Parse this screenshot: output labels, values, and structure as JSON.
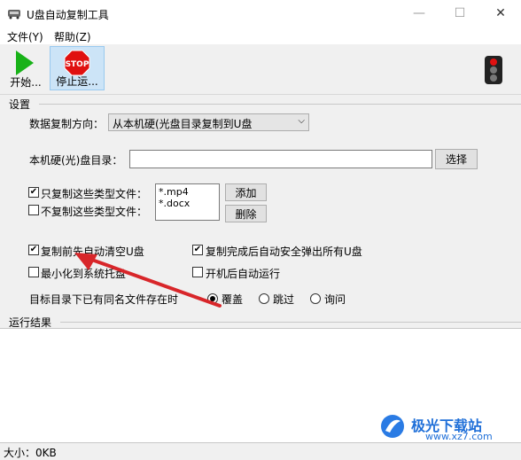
{
  "window": {
    "title": "U盘自动复制工具",
    "min_icon": "minimize-icon",
    "max_icon": "maximize-icon",
    "close_icon": "close-icon"
  },
  "menu": [
    {
      "label": "文件(Y)"
    },
    {
      "label": "帮助(Z)"
    }
  ],
  "toolbar": {
    "start_label": "开始...",
    "stop_label": "停止运...",
    "stop_sign_text": "STOP"
  },
  "settings": {
    "group_label": "设置",
    "direction_label": "数据复制方向：",
    "direction_value": "从本机硬(光盘目录复制到U盘",
    "dir_label": "本机硬(光)盘目录：",
    "dir_value": "",
    "browse_label": "选择",
    "only_types_label": "只复制这些类型文件：",
    "only_types_checked": true,
    "exclude_types_label": "不复制这些类型文件：",
    "exclude_types_checked": false,
    "types_list": [
      "*.mp4",
      "*.docx"
    ],
    "add_label": "添加",
    "delete_label": "删除",
    "clear_before_label": "复制前先自动清空U盘",
    "clear_before_checked": true,
    "eject_after_label": "复制完成后自动安全弹出所有U盘",
    "eject_after_checked": true,
    "minimize_tray_label": "最小化到系统托盘",
    "minimize_tray_checked": false,
    "autostart_label": "开机后自动运行",
    "autostart_checked": false,
    "exists_label": "目标目录下已有同名文件存在时",
    "exists_options": [
      "覆盖",
      "跳过",
      "询问"
    ],
    "exists_selected": "覆盖"
  },
  "results": {
    "group_label": "运行结果"
  },
  "status": {
    "size_text": "大小：0KB"
  },
  "watermark": {
    "text": "极光下载站",
    "url_text": "www.xz7.com"
  },
  "colors": {
    "start_green": "#18b218",
    "stop_red": "#e01010",
    "toolbar_active": "#cce4f7",
    "arrow_red": "#d8262a"
  }
}
